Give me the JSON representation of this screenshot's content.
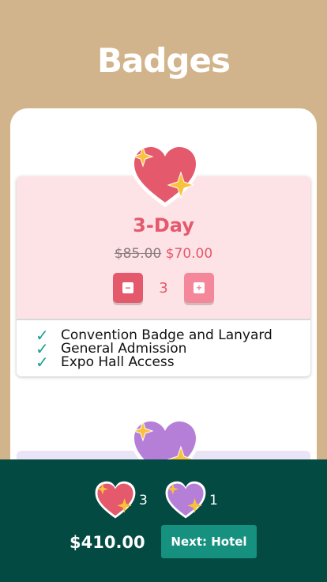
{
  "header": {
    "title": "Badges"
  },
  "badges": [
    {
      "name": "3-Day",
      "original_price": "$85.00",
      "price": "$70.00",
      "quantity": "3",
      "features": [
        "Convention Badge and Lanyard",
        "General Admission",
        "Expo Hall Access"
      ],
      "color": "#e4596c"
    },
    {
      "color": "#b57fd8"
    }
  ],
  "cart": {
    "items": [
      {
        "icon": "pink-heart-icon",
        "count": "3"
      },
      {
        "icon": "purple-heart-icon",
        "count": "1"
      }
    ],
    "total": "$410.00",
    "next_label": "Next: Hotel"
  },
  "colors": {
    "background": "#d2b48c",
    "footer": "#034a42",
    "accent": "#16907f",
    "pink": "#e4596c",
    "purple": "#b57fd8"
  }
}
